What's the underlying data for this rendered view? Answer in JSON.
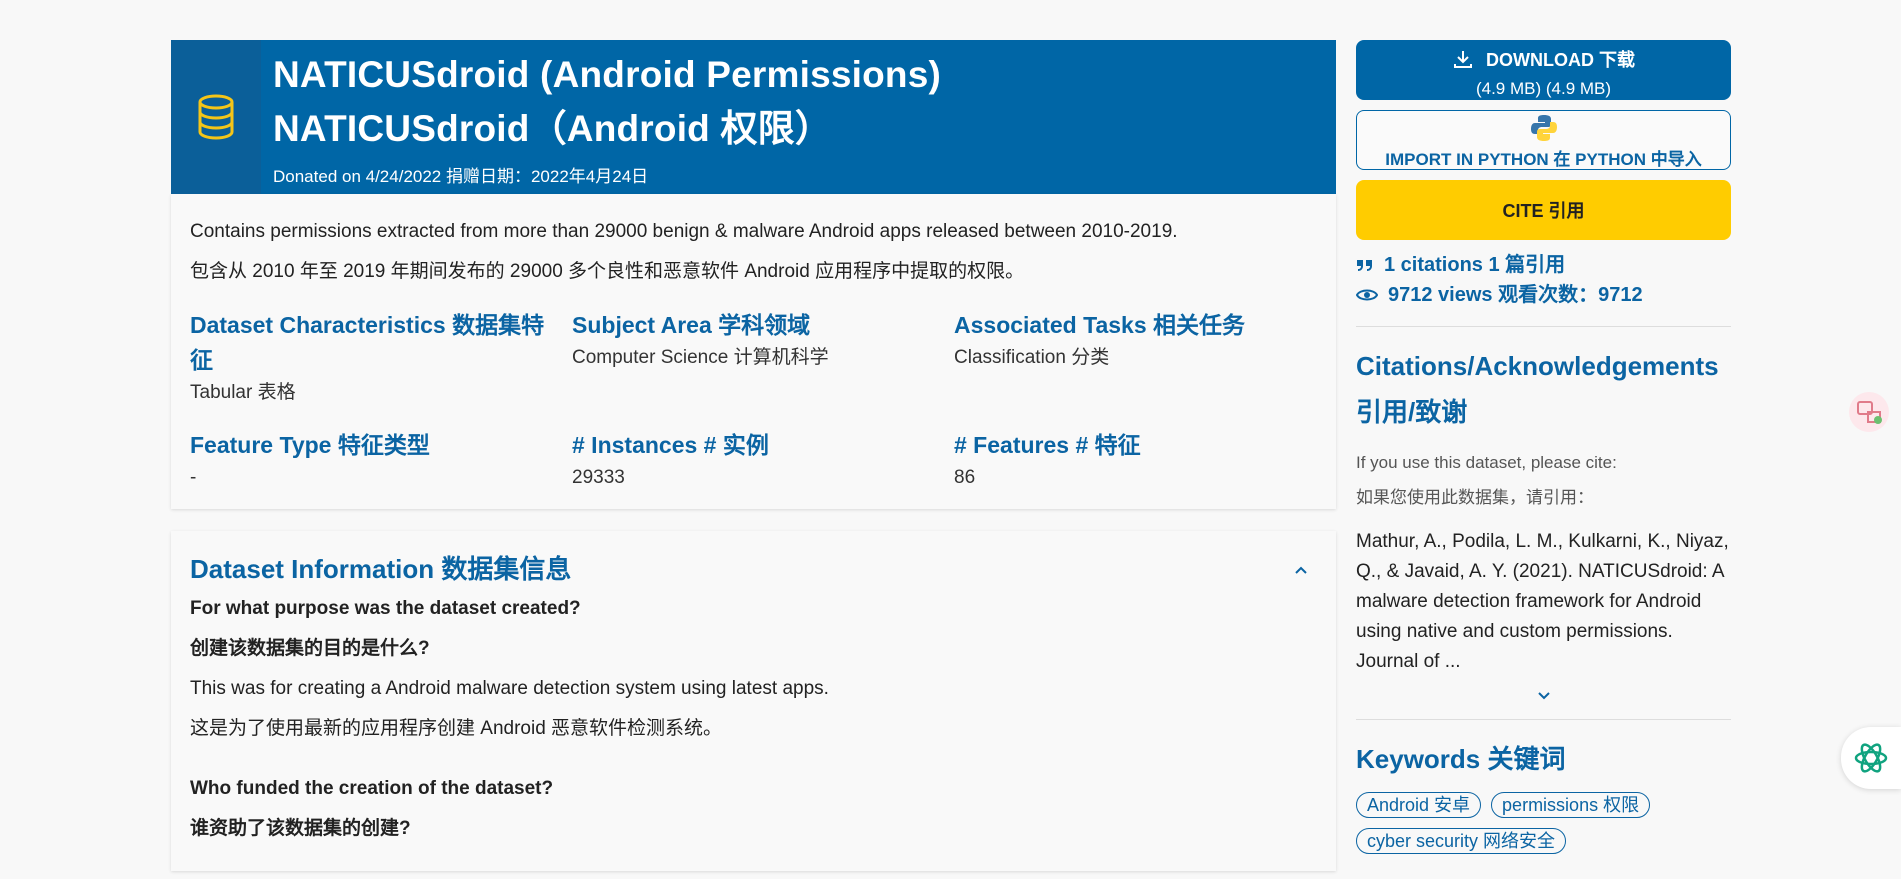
{
  "hero": {
    "title_en": "NATICUSdroid (Android Permissions)",
    "title_zh": "NATICUSdroid（Android 权限）",
    "donated": "Donated on 4/24/2022  捐赠日期：2022年4月24日"
  },
  "summary": {
    "desc_en": "Contains permissions extracted from more than 29000 benign & malware Android apps released between 2010-2019.",
    "desc_zh": "包含从 2010 年至 2019 年期间发布的 29000 多个良性和恶意软件 Android 应用程序中提取的权限。",
    "fields": [
      {
        "label": "Dataset Characteristics  数据集特征",
        "value": "Tabular  表格"
      },
      {
        "label": "Subject Area  学科领域",
        "value": "Computer Science  计算机科学"
      },
      {
        "label": "Associated Tasks  相关任务",
        "value": "Classification  分类"
      },
      {
        "label": "Feature Type  特征类型",
        "value": "-"
      },
      {
        "label": "# Instances  # 实例",
        "value": "29333"
      },
      {
        "label": "# Features  # 特征",
        "value": "86"
      }
    ]
  },
  "info": {
    "title": "Dataset Information  数据集信息",
    "q1_en": "For what purpose was the dataset created?",
    "q1_zh": "创建该数据集的目的是什么?",
    "a1_en": "This was for creating a Android malware detection system using latest apps.",
    "a1_zh": "这是为了使用最新的应用程序创建 Android 恶意软件检测系统。",
    "q2_en": "Who funded the creation of the dataset?",
    "q2_zh": "谁资助了该数据集的创建?"
  },
  "side": {
    "download_label": "DOWNLOAD  下载",
    "download_size": "(4.9 MB)    (4.9 MB)",
    "python_label": "IMPORT IN PYTHON  在 PYTHON 中导入",
    "cite_label": "CITE    引用",
    "citations": "1 citations  1 篇引用",
    "views": "9712 views  观看次数：9712",
    "ack_title_en": "Citations/Acknowledgements",
    "ack_title_zh": "引用/致谢",
    "please_cite_en": "If you use this dataset, please cite:",
    "please_cite_zh": "如果您使用此数据集，请引用：",
    "citation_text": "Mathur, A., Podila, L. M., Kulkarni, K., Niyaz, Q., & Javaid, A. Y. (2021). NATICUSdroid: A malware detection framework for Android using native and custom permissions. Journal of ...",
    "keywords_title": "Keywords  关键词",
    "keywords": [
      "Android  安卓",
      "permissions  权限",
      "cyber security  网络安全"
    ]
  },
  "icons": {
    "hero": "database-icon",
    "download": "download-icon",
    "python": "python-logo-icon",
    "quote": "quote-icon",
    "views": "eye-icon",
    "collapse": "chevron-up-icon",
    "expand": "chevron-down-icon",
    "translate": "translate-icon",
    "assistant": "openai-icon"
  },
  "colors": {
    "primary": "#0066a6",
    "accent": "#ffcc00"
  }
}
